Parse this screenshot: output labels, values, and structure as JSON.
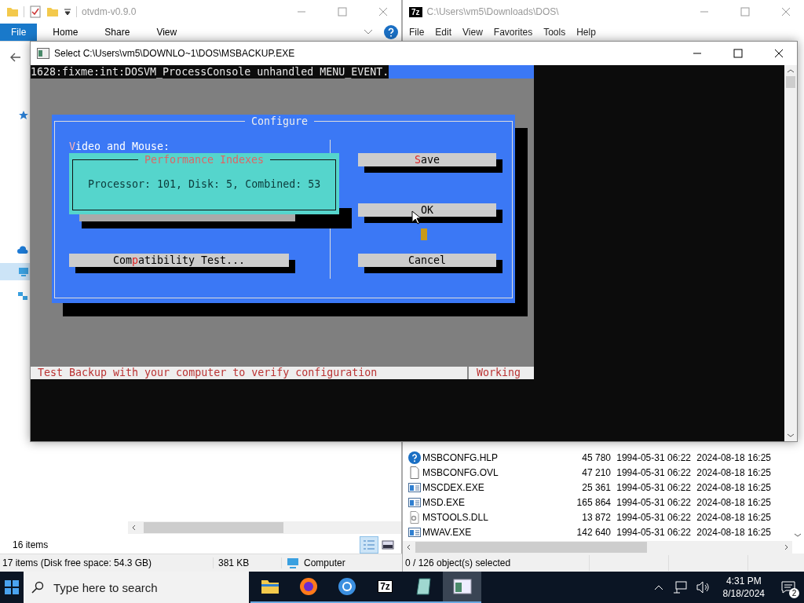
{
  "explorer": {
    "title": "otvdm-v0.9.0",
    "ribbon_tabs": [
      {
        "label": "File",
        "selected": true
      },
      {
        "label": "Home",
        "selected": false
      },
      {
        "label": "Share",
        "selected": false
      },
      {
        "label": "View",
        "selected": false
      }
    ],
    "item_count": "16 items"
  },
  "status_strip": {
    "items": "17 items (Disk free space: 54.3 GB)",
    "size": "381 KB",
    "location": "Computer"
  },
  "sevenzip": {
    "icon_label": "7z",
    "title": "C:\\Users\\vm5\\Downloads\\DOS\\",
    "menu": [
      "File",
      "Edit",
      "View",
      "Favorites",
      "Tools",
      "Help"
    ],
    "files": [
      {
        "kind": "help",
        "name": "MSBCONFG.HLP",
        "size": "45 780",
        "modified": "1994-05-31 06:22",
        "created": "2024-08-18 16:25"
      },
      {
        "kind": "file",
        "name": "MSBCONFG.OVL",
        "size": "47 210",
        "modified": "1994-05-31 06:22",
        "created": "2024-08-18 16:25"
      },
      {
        "kind": "exe",
        "name": "MSCDEX.EXE",
        "size": "25 361",
        "modified": "1994-05-31 06:22",
        "created": "2024-08-18 16:25"
      },
      {
        "kind": "exe",
        "name": "MSD.EXE",
        "size": "165 864",
        "modified": "1994-05-31 06:22",
        "created": "2024-08-18 16:25"
      },
      {
        "kind": "dll",
        "name": "MSTOOLS.DLL",
        "size": "13 872",
        "modified": "1994-05-31 06:22",
        "created": "2024-08-18 16:25"
      },
      {
        "kind": "exe",
        "name": "MWAV.EXE",
        "size": "142 640",
        "modified": "1994-05-31 06:22",
        "created": "2024-08-18 16:25"
      }
    ],
    "status": "0 / 126 object(s) selected"
  },
  "console": {
    "title": "Select C:\\Users\\vm5\\DOWNLO~1\\DOS\\MSBACKUP.EXE",
    "log_line": "1628:fixme:int:DOSVM_ProcessConsole unhandled MENU_EVENT.",
    "dialog": {
      "title": "Configure",
      "section_label": [
        {
          "text": "V",
          "hotkey": true
        },
        {
          "text": "ideo and Mouse:",
          "hotkey": false
        }
      ],
      "popup": {
        "title": "Performance Indexes",
        "text": "Processor: 101, Disk: 5, Combined: 53"
      },
      "left_buttons": [
        {
          "parts": [
            {
              "text": "Com",
              "hotkey": false
            },
            {
              "text": "p",
              "hotkey": true
            },
            {
              "text": "atibility Test...",
              "hotkey": false
            }
          ]
        }
      ],
      "right_buttons": [
        {
          "parts": [
            {
              "text": "S",
              "hotkey": true
            },
            {
              "text": "ave",
              "hotkey": false
            }
          ]
        },
        {
          "parts": [
            {
              "text": "OK",
              "hotkey": false
            }
          ]
        },
        {
          "parts": [
            {
              "text": "Cancel",
              "hotkey": false
            }
          ]
        }
      ]
    },
    "status": "Test Backup with your computer to verify configuration",
    "state": "Working"
  },
  "taskbar": {
    "search_placeholder": "Type here to search",
    "apps": [
      {
        "kind": "folder",
        "selected": false
      },
      {
        "kind": "firefox",
        "selected": false
      },
      {
        "kind": "browser",
        "selected": false
      },
      {
        "kind": "sevenzip",
        "label": "7z",
        "selected": false
      },
      {
        "kind": "notepad",
        "selected": false
      },
      {
        "kind": "console",
        "selected": true
      }
    ],
    "time": "4:31 PM",
    "date": "8/18/2024",
    "notifications": "2"
  }
}
